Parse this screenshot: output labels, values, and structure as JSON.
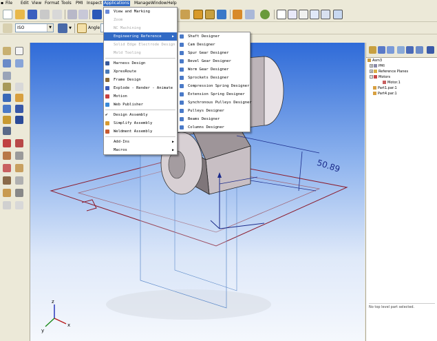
{
  "menubar": {
    "items": [
      "File",
      "Edit",
      "View",
      "Format",
      "Tools",
      "PMI",
      "Inspect",
      "Applications",
      "Manage",
      "Window",
      "Help"
    ],
    "active": "Applications"
  },
  "toolbar": {
    "standard_combo_value": "ISO",
    "angle_label": "Angle"
  },
  "applications_menu": {
    "items": [
      {
        "label": "View and Marking",
        "state": "enabled",
        "icon": "view-marking-icon"
      },
      {
        "label": "Zoom",
        "state": "disabled",
        "icon": ""
      },
      {
        "label": "NC Machining",
        "state": "disabled",
        "icon": ""
      },
      {
        "label": "Engineering Reference",
        "state": "highlighted",
        "icon": "",
        "submenu": true
      },
      {
        "label": "Solid Edge Electrode Design",
        "state": "disabled",
        "icon": ""
      },
      {
        "label": "Mold Tooling",
        "state": "disabled",
        "icon": ""
      },
      {
        "label": "Harness Design",
        "state": "enabled",
        "icon": "harness-icon"
      },
      {
        "label": "XpresRoute",
        "state": "enabled",
        "icon": "xpresroute-icon"
      },
      {
        "label": "Frame Design",
        "state": "enabled",
        "icon": "frame-icon"
      },
      {
        "label": "Explode - Render - Animate",
        "state": "enabled",
        "icon": "explode-icon"
      },
      {
        "label": "Motion",
        "state": "enabled",
        "icon": "motion-icon"
      },
      {
        "label": "Web Publisher",
        "state": "enabled",
        "icon": "web-icon"
      },
      {
        "label": "Design Assembly",
        "state": "enabled",
        "icon": "check-icon"
      },
      {
        "label": "Simplify Assembly",
        "state": "enabled",
        "icon": "simplify-icon"
      },
      {
        "label": "Weldment Assembly",
        "state": "enabled",
        "icon": "weldment-icon"
      },
      {
        "label": "Add-Ins",
        "state": "enabled",
        "icon": "",
        "submenu": true
      },
      {
        "label": "Macros",
        "state": "enabled",
        "icon": "",
        "submenu": true
      }
    ]
  },
  "engineering_reference_submenu": {
    "items": [
      "Shaft Designer",
      "Cam Designer",
      "Spur Gear Designer",
      "Bevel Gear Designer",
      "Worm Gear Designer",
      "Sprockets Designer",
      "Compression Spring Designer",
      "Extension Spring Designer",
      "Synchronous Pulleys Designer",
      "Pulleys Designer",
      "Beams Designer",
      "Columns Designer"
    ]
  },
  "viewport": {
    "dimension_value": "50.89",
    "triad_labels": [
      "z",
      "x",
      "y"
    ]
  },
  "tree": {
    "items": [
      {
        "label": "Asm3",
        "level": 0,
        "expander": ""
      },
      {
        "label": "PMI",
        "level": 1,
        "expander": "+"
      },
      {
        "label": "Reference Planes",
        "level": 1,
        "expander": "+"
      },
      {
        "label": "Motors",
        "level": 1,
        "expander": "−"
      },
      {
        "label": "Motor.1",
        "level": 2,
        "expander": ""
      },
      {
        "label": "Part1.par:1",
        "level": 1,
        "expander": ""
      },
      {
        "label": "Part4.par:1",
        "level": 1,
        "expander": ""
      }
    ],
    "footer_text": "No top level part selected."
  },
  "colors": {
    "menu_highlight": "#316ac5",
    "viewport_top": "#2f6bd8",
    "viewport_bottom": "#f5f8fd",
    "part_outline": "#8b1a2b",
    "dimension_color": "#1a2a8a"
  }
}
